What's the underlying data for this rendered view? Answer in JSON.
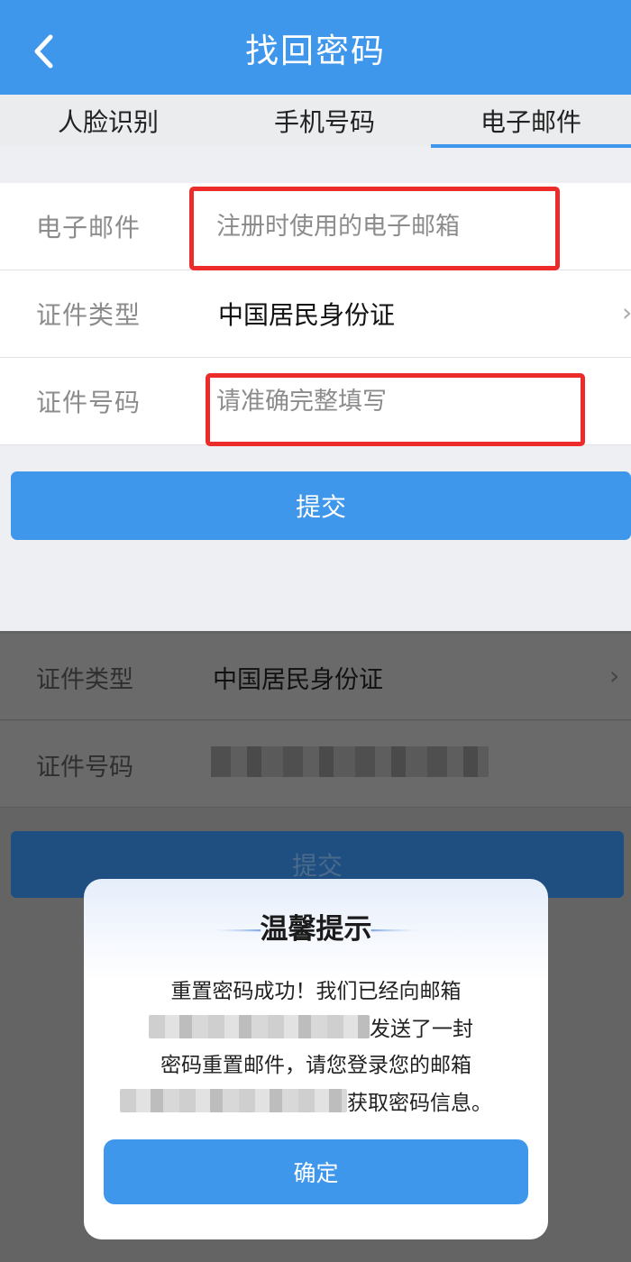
{
  "header": {
    "title": "找回密码",
    "back_icon": "chevron-left-icon"
  },
  "tabs": [
    {
      "label": "人脸识别"
    },
    {
      "label": "手机号码"
    },
    {
      "label": "电子邮件",
      "active": true
    }
  ],
  "form": {
    "email": {
      "label": "电子邮件",
      "placeholder": "注册时使用的电子邮箱"
    },
    "id_type": {
      "label": "证件类型",
      "value": "中国居民身份证"
    },
    "id_number": {
      "label": "证件号码",
      "placeholder": "请准确完整填写"
    },
    "submit_label": "提交"
  },
  "background_form": {
    "id_type": {
      "label": "证件类型",
      "value": "中国居民身份证"
    },
    "id_number": {
      "label": "证件号码"
    },
    "submit_label": "提交"
  },
  "dialog": {
    "title": "温馨提示",
    "line1": "重置密码成功！我们已经向邮箱",
    "line2_suffix": "发送了一封",
    "line3": "密码重置邮件，请您登录您的邮箱",
    "line4_suffix": "获取密码信息。",
    "confirm_label": "确定"
  },
  "colors": {
    "accent": "#3f97ec",
    "highlight": "#ec2b2b",
    "overlay": "#646464"
  }
}
